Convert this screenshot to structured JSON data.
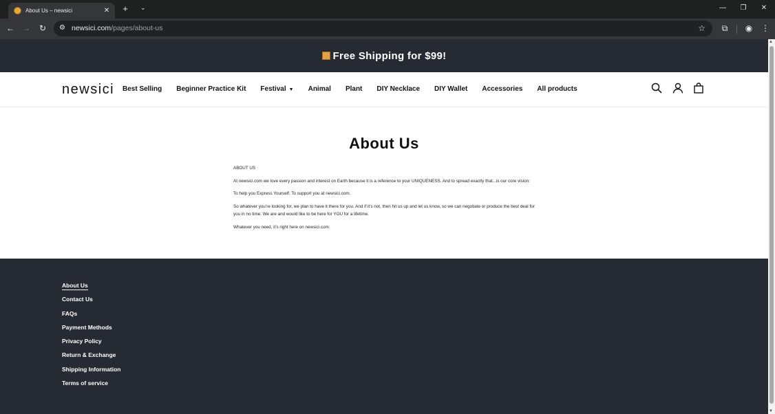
{
  "browser": {
    "tab_title": "About Us – newsici",
    "url_host": "newsici.com",
    "url_path": "/pages/about-us"
  },
  "site": {
    "announcement": "Free Shipping for $99!",
    "logo": "newsici",
    "nav": [
      "Best Selling",
      "Beginner Practice Kit",
      "Festival",
      "Animal",
      "Plant",
      "DIY Necklace",
      "DIY Wallet",
      "Accessories",
      "All products"
    ]
  },
  "page": {
    "title": "About Us",
    "section_heading": "ABOUT US",
    "paragraphs": [
      "At newsici.com  we love every passion and interest on Earth because it is a reference to your UNIQUENESS. And to spread exactly that...is our core vision:",
      "To help you Express Yourself. To support you at newsici.com.",
      "So whatever you’re looking for, we plan to have it there for you. And if it’s not, then hit us up and let us know, so we can negotiate or produce the best deal for you in no time. We are and would like to be here for YOU for a lifetime.",
      "Whatever you need, it’s right here on newsici.com."
    ]
  },
  "footer": {
    "links": [
      "About Us",
      "Contact Us",
      "FAQs",
      "Payment Methods",
      "Privacy Policy",
      "Return & Exchange",
      "Shipping Information",
      "Terms of service"
    ]
  },
  "colors": {
    "announce_bg": "#262b33",
    "footer_bg": "#262b33",
    "chrome_bg": "#35363a"
  }
}
